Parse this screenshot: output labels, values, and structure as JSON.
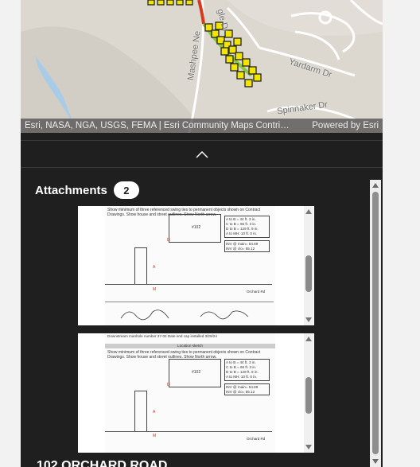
{
  "map": {
    "attribution": "Esri, NASA, NGA, USGS, FEMA | Esri Community Maps Contri…",
    "powered_by": "Powered by Esri",
    "road_labels": [
      "Mashpee Ne",
      "gle Dr",
      "Yardarm Dr",
      "Spinnaker Dr"
    ]
  },
  "collapse": {
    "icon": "chevron-up-icon"
  },
  "attachments": {
    "title": "Attachments",
    "count": "2",
    "items": [
      {
        "instructions": "Show minimum of three referenced swing ties to permanent objects shown on Contract Drawings. Show house and street outlines. Show North arrow.",
        "house_label": "#102",
        "ties": [
          "A to B = 44 ft. 3 in.",
          "C to B = 66 ft. 3 in.",
          "D to B = 129 ft. 9 in.",
          "A to MH: 10 ft. 0 in."
        ],
        "inv_main": "INV @ main= 54.89",
        "inv_clo": "INV @ clo= 55.12",
        "road": "Orchard Rd"
      },
      {
        "header": "Downstream manhole number 37-02   Date end cap installed 3/29/24",
        "section": "Location sketch",
        "instructions": "Show minimum of three referenced swing ties to permanent objects shown on Contract Drawings. Show house and street outlines. Show North arrow.",
        "house_label": "#102",
        "ties": [
          "A to B = 44 ft. 3 in.",
          "C to B = 66 ft. 3 in.",
          "D to B = 129 ft. 9 in.",
          "A to MH: 10 ft. 0 in."
        ],
        "inv_main": "INV @ main= 54.89",
        "inv_clo": "INV @ clo= 55.12",
        "road": "Orchard Rd"
      }
    ]
  },
  "record": {
    "title": "102 ORCHARD ROAD"
  },
  "colors": {
    "panel_bg": "#1f1f1f",
    "map_bg": "#dcd8cf",
    "marker_fill": "#f2e600",
    "route": "#8cc63f"
  }
}
